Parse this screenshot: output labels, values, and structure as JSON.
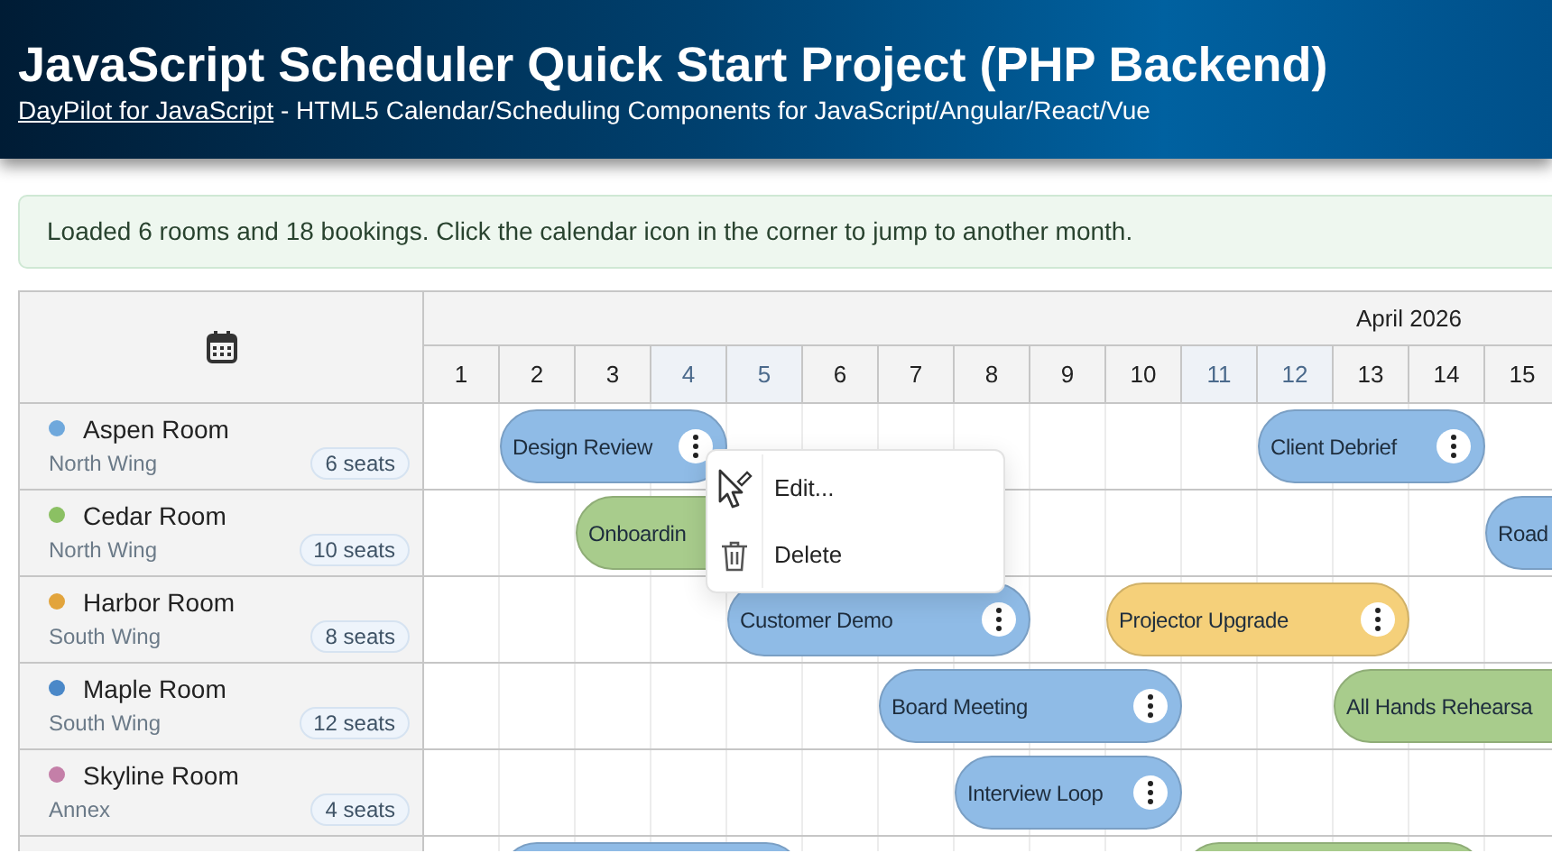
{
  "header": {
    "title": "JavaScript Scheduler Quick Start Project (PHP Backend)",
    "link": "DayPilot for JavaScript",
    "subtitle": " - HTML5 Calendar/Scheduling Components for JavaScript/Angular/React/Vue"
  },
  "alert": {
    "text": "Loaded 6 rooms and 18 bookings. Click the calendar icon in the corner to jump to another month."
  },
  "scheduler": {
    "month": "April 2026",
    "days": [
      {
        "label": "1",
        "weekend": false
      },
      {
        "label": "2",
        "weekend": false
      },
      {
        "label": "3",
        "weekend": false
      },
      {
        "label": "4",
        "weekend": true
      },
      {
        "label": "5",
        "weekend": true
      },
      {
        "label": "6",
        "weekend": false
      },
      {
        "label": "7",
        "weekend": false
      },
      {
        "label": "8",
        "weekend": false
      },
      {
        "label": "9",
        "weekend": false
      },
      {
        "label": "10",
        "weekend": false
      },
      {
        "label": "11",
        "weekend": true
      },
      {
        "label": "12",
        "weekend": true
      },
      {
        "label": "13",
        "weekend": false
      },
      {
        "label": "14",
        "weekend": false
      },
      {
        "label": "15",
        "weekend": false
      }
    ],
    "rows": [
      {
        "room": {
          "name": "Aspen Room",
          "wing": "North Wing",
          "seats": "6 seats",
          "color": "#6fa8dc"
        },
        "events": [
          {
            "text": "Design Review",
            "color": "#8fbbe6"
          },
          {
            "text": "Client Debrief",
            "color": "#8fbbe6"
          }
        ]
      },
      {
        "room": {
          "name": "Cedar Room",
          "wing": "North Wing",
          "seats": "10 seats",
          "color": "#8bc063"
        },
        "events": [
          {
            "text": "Onboardin",
            "color": "#a8cc8c"
          },
          {
            "text": "Road",
            "color": "#8fbbe6"
          }
        ]
      },
      {
        "room": {
          "name": "Harbor Room",
          "wing": "South Wing",
          "seats": "8 seats",
          "color": "#e2a43c"
        },
        "events": [
          {
            "text": "Customer Demo",
            "color": "#8fbbe6"
          },
          {
            "text": "Projector Upgrade",
            "color": "#f5d07a"
          }
        ]
      },
      {
        "room": {
          "name": "Maple Room",
          "wing": "South Wing",
          "seats": "12 seats",
          "color": "#4a88c8"
        },
        "events": [
          {
            "text": "Board Meeting",
            "color": "#8fbbe6"
          },
          {
            "text": "All Hands Rehearsa",
            "color": "#a8cc8c"
          }
        ]
      },
      {
        "room": {
          "name": "Skyline Room",
          "wing": "Annex",
          "seats": "4 seats",
          "color": "#c47fa8"
        },
        "events": [
          {
            "text": "Interview Loop",
            "color": "#8fbbe6"
          }
        ]
      },
      {
        "events": [
          {
            "color": "#8fbbe6"
          },
          {
            "color": "#a8cc8c"
          }
        ]
      }
    ],
    "context_menu": {
      "items": [
        {
          "kind": "edit",
          "label": "Edit..."
        },
        {
          "kind": "delete",
          "label": "Delete"
        }
      ]
    }
  }
}
